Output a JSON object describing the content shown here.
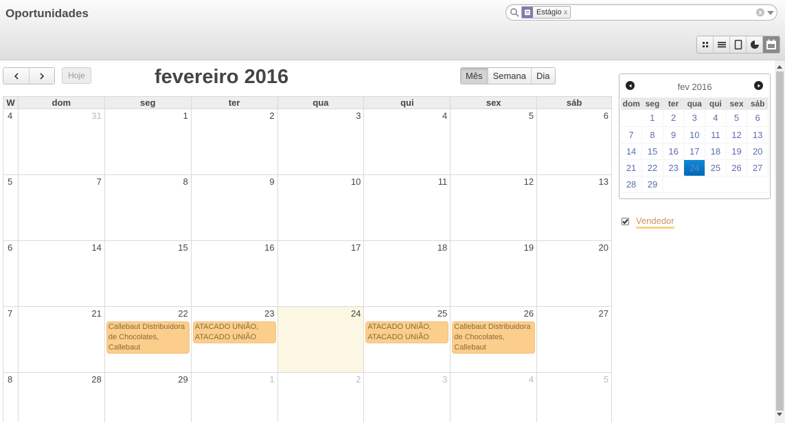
{
  "header": {
    "title": "Oportunidades",
    "search": {
      "facet_value": "Estágio",
      "facet_remove": "x",
      "clear": "x"
    },
    "views": [
      "kanban-icon",
      "list-icon",
      "form-icon",
      "graph-icon",
      "calendar-icon"
    ],
    "active_view": "calendar-icon"
  },
  "toolbar": {
    "prev": "‹",
    "next": "›",
    "today": "Hoje",
    "title": "fevereiro 2016",
    "modes": [
      "Mês",
      "Semana",
      "Dia"
    ],
    "active_mode": "Mês"
  },
  "calendar": {
    "week_header": "W",
    "day_headers": [
      "dom",
      "seg",
      "ter",
      "qua",
      "qui",
      "sex",
      "sáb"
    ],
    "weeks": [
      {
        "week": "4",
        "days": [
          {
            "d": "31",
            "other": true
          },
          {
            "d": "1"
          },
          {
            "d": "2"
          },
          {
            "d": "3"
          },
          {
            "d": "4"
          },
          {
            "d": "5"
          },
          {
            "d": "6"
          }
        ]
      },
      {
        "week": "5",
        "days": [
          {
            "d": "7"
          },
          {
            "d": "8"
          },
          {
            "d": "9"
          },
          {
            "d": "10"
          },
          {
            "d": "11"
          },
          {
            "d": "12"
          },
          {
            "d": "13"
          }
        ]
      },
      {
        "week": "6",
        "days": [
          {
            "d": "14"
          },
          {
            "d": "15"
          },
          {
            "d": "16"
          },
          {
            "d": "17"
          },
          {
            "d": "18"
          },
          {
            "d": "19"
          },
          {
            "d": "20"
          }
        ]
      },
      {
        "week": "7",
        "days": [
          {
            "d": "21"
          },
          {
            "d": "22",
            "event": "Callebaut Distribuidora de Chocolates, Callebaut"
          },
          {
            "d": "23",
            "event": "ATACADO UNIÃO, ATACADO UNIÃO"
          },
          {
            "d": "24",
            "today": true
          },
          {
            "d": "25",
            "event": "ATACADO UNIÃO, ATACADO UNIÃO"
          },
          {
            "d": "26",
            "event": "Callebaut Distribuidora de Chocolates, Callebaut"
          },
          {
            "d": "27"
          }
        ]
      },
      {
        "week": "8",
        "days": [
          {
            "d": "28"
          },
          {
            "d": "29"
          },
          {
            "d": "1",
            "other": true
          },
          {
            "d": "2",
            "other": true
          },
          {
            "d": "3",
            "other": true
          },
          {
            "d": "4",
            "other": true
          },
          {
            "d": "5",
            "other": true
          }
        ]
      }
    ],
    "event_color": "#fbce8c",
    "today_color": "#fcf7e3"
  },
  "mini_calendar": {
    "title": "fev 2016",
    "day_headers": [
      "dom",
      "seg",
      "ter",
      "qua",
      "qui",
      "sex",
      "sáb"
    ],
    "rows": [
      [
        "",
        "1",
        "2",
        "3",
        "4",
        "5",
        "6"
      ],
      [
        "7",
        "8",
        "9",
        "10",
        "11",
        "12",
        "13"
      ],
      [
        "14",
        "15",
        "16",
        "17",
        "18",
        "19",
        "20"
      ],
      [
        "21",
        "22",
        "23",
        "24",
        "25",
        "26",
        "27"
      ],
      [
        "28",
        "29",
        "",
        "",
        "",
        "",
        ""
      ]
    ],
    "selected": "24"
  },
  "legend": {
    "label": "Vendedor",
    "checked": true
  }
}
